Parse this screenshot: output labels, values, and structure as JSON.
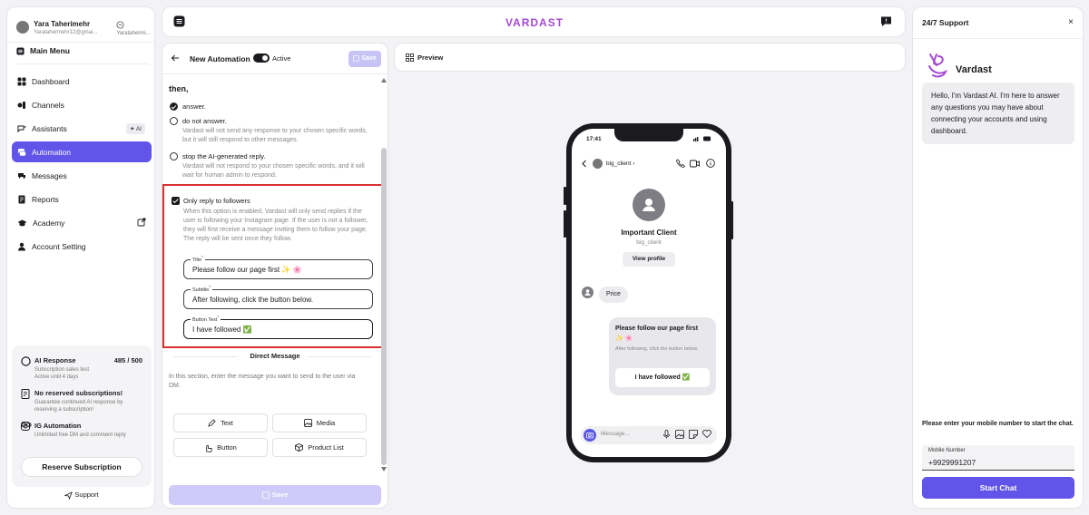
{
  "user": {
    "name": "Yara Taherimehr",
    "email": "Yaratahermehr12@gmai...",
    "switch_label": "Yaratahermi..."
  },
  "sidebar": {
    "main_menu": "Main Menu",
    "items": [
      {
        "label": "Dashboard",
        "icon": "dashboard-icon"
      },
      {
        "label": "Channels",
        "icon": "channels-icon"
      },
      {
        "label": "Assistants",
        "icon": "assistants-icon",
        "badge": "AI"
      },
      {
        "label": "Automation",
        "icon": "automation-icon",
        "active": true
      },
      {
        "label": "Messages",
        "icon": "messages-icon"
      },
      {
        "label": "Reports",
        "icon": "reports-icon"
      },
      {
        "label": "Academy",
        "icon": "academy-icon"
      },
      {
        "label": "Account Setting",
        "icon": "account-icon"
      }
    ],
    "subscription": {
      "ai_response": {
        "title": "AI Response",
        "count": "485 / 500",
        "desc": "Subscription sales test\nActive until 4 days"
      },
      "no_reserved": {
        "title": "No reserved subscriptions!",
        "desc": "Guarantee continued AI response by reserving a subscription!"
      },
      "ig_automation": {
        "title": "IG Automation",
        "desc": "Unlimited free DM and comment reply"
      },
      "reserve_button": "Reserve Subscription"
    },
    "support_link": "Support"
  },
  "topbar": {
    "brand": "VARDAST"
  },
  "editor": {
    "title": "New Automation",
    "toggle_label": "Active",
    "save_label": "Save",
    "then_label": "then,",
    "options": [
      {
        "label": "answer.",
        "checked": true,
        "desc": ""
      },
      {
        "label": "do not answer.",
        "checked": false,
        "desc": "Vardast will not send any response to your chosen specific words, but it will still respond to other messages."
      },
      {
        "label": "stop the AI-generated reply.",
        "checked": false,
        "desc": "Vardast will not respond to your chosen specific words, and it will wait for human admin to respond."
      }
    ],
    "followers": {
      "label": "Only reply to followers",
      "desc": "When this option is enabled, Vardast will only send replies if the user is following your Instagram page. If the user is not a follower, they will first receive a message inviting them to follow your page. The reply will be sent once they follow.",
      "title_label": "Title",
      "title_value": "Please follow our page first ✨ 🌸",
      "subtitle_label": "Subtitle",
      "subtitle_value": "After following, click the button below.",
      "button_label": "Button Text",
      "button_value": "I have followed ✅"
    },
    "dm": {
      "title": "Direct Message",
      "desc": "In this section, enter the message you want to send to the user via DM.",
      "buttons": [
        "Text",
        "Media",
        "Button",
        "Product List"
      ]
    },
    "save_bottom": "Save"
  },
  "preview": {
    "label": "Preview",
    "status_time": "17:41",
    "handle": "big_client",
    "profile_name": "Important Client",
    "profile_handle": "big_client",
    "view_profile": "View profile",
    "incoming": "Price",
    "card_title": "Please follow our page first ✨ 🌸",
    "card_subtitle": "After following, click the button below.",
    "card_button": "I have followed ✅",
    "composer_placeholder": "Message..."
  },
  "support": {
    "title": "24/7 Support",
    "brand": "Vardast",
    "greeting": "Hello, I'm Vardast AI. I'm here to answer any questions you may have about connecting your accounts and using dashboard.",
    "prompt": "Please enter your mobile number to start the chat.",
    "field_label": "Mobile Number",
    "field_value": "+9929991207",
    "start_button": "Start Chat"
  },
  "colors": {
    "accent": "#6055e8",
    "brand": "#a64ad2",
    "highlight": "#d93030"
  }
}
